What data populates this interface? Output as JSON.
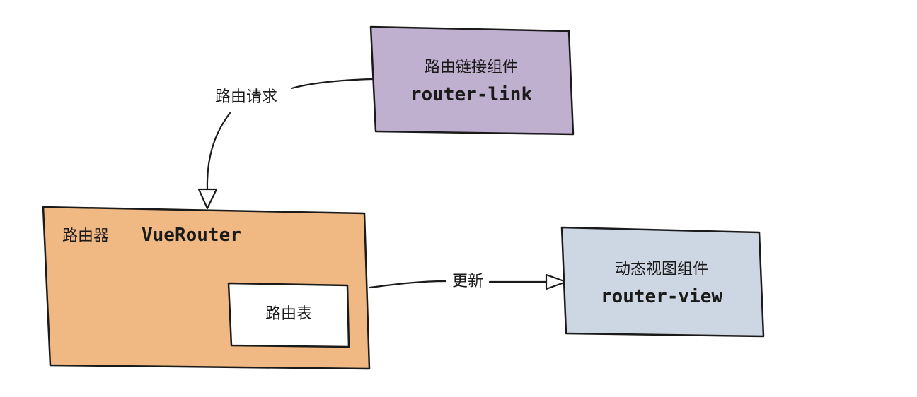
{
  "colors": {
    "router_link_fill": "#bfb0cf",
    "router_fill": "#f0b882",
    "route_table_fill": "#ffffff",
    "router_view_fill": "#cdd6e3",
    "stroke": "#1a1a1a"
  },
  "router_link": {
    "title": "路由链接组件",
    "code": "router-link"
  },
  "router": {
    "title": "路由器",
    "code": "VueRouter"
  },
  "route_table": {
    "label": "路由表"
  },
  "router_view": {
    "title": "动态视图组件",
    "code": "router-view"
  },
  "edges": {
    "route_request": "路由请求",
    "update": "更新"
  }
}
